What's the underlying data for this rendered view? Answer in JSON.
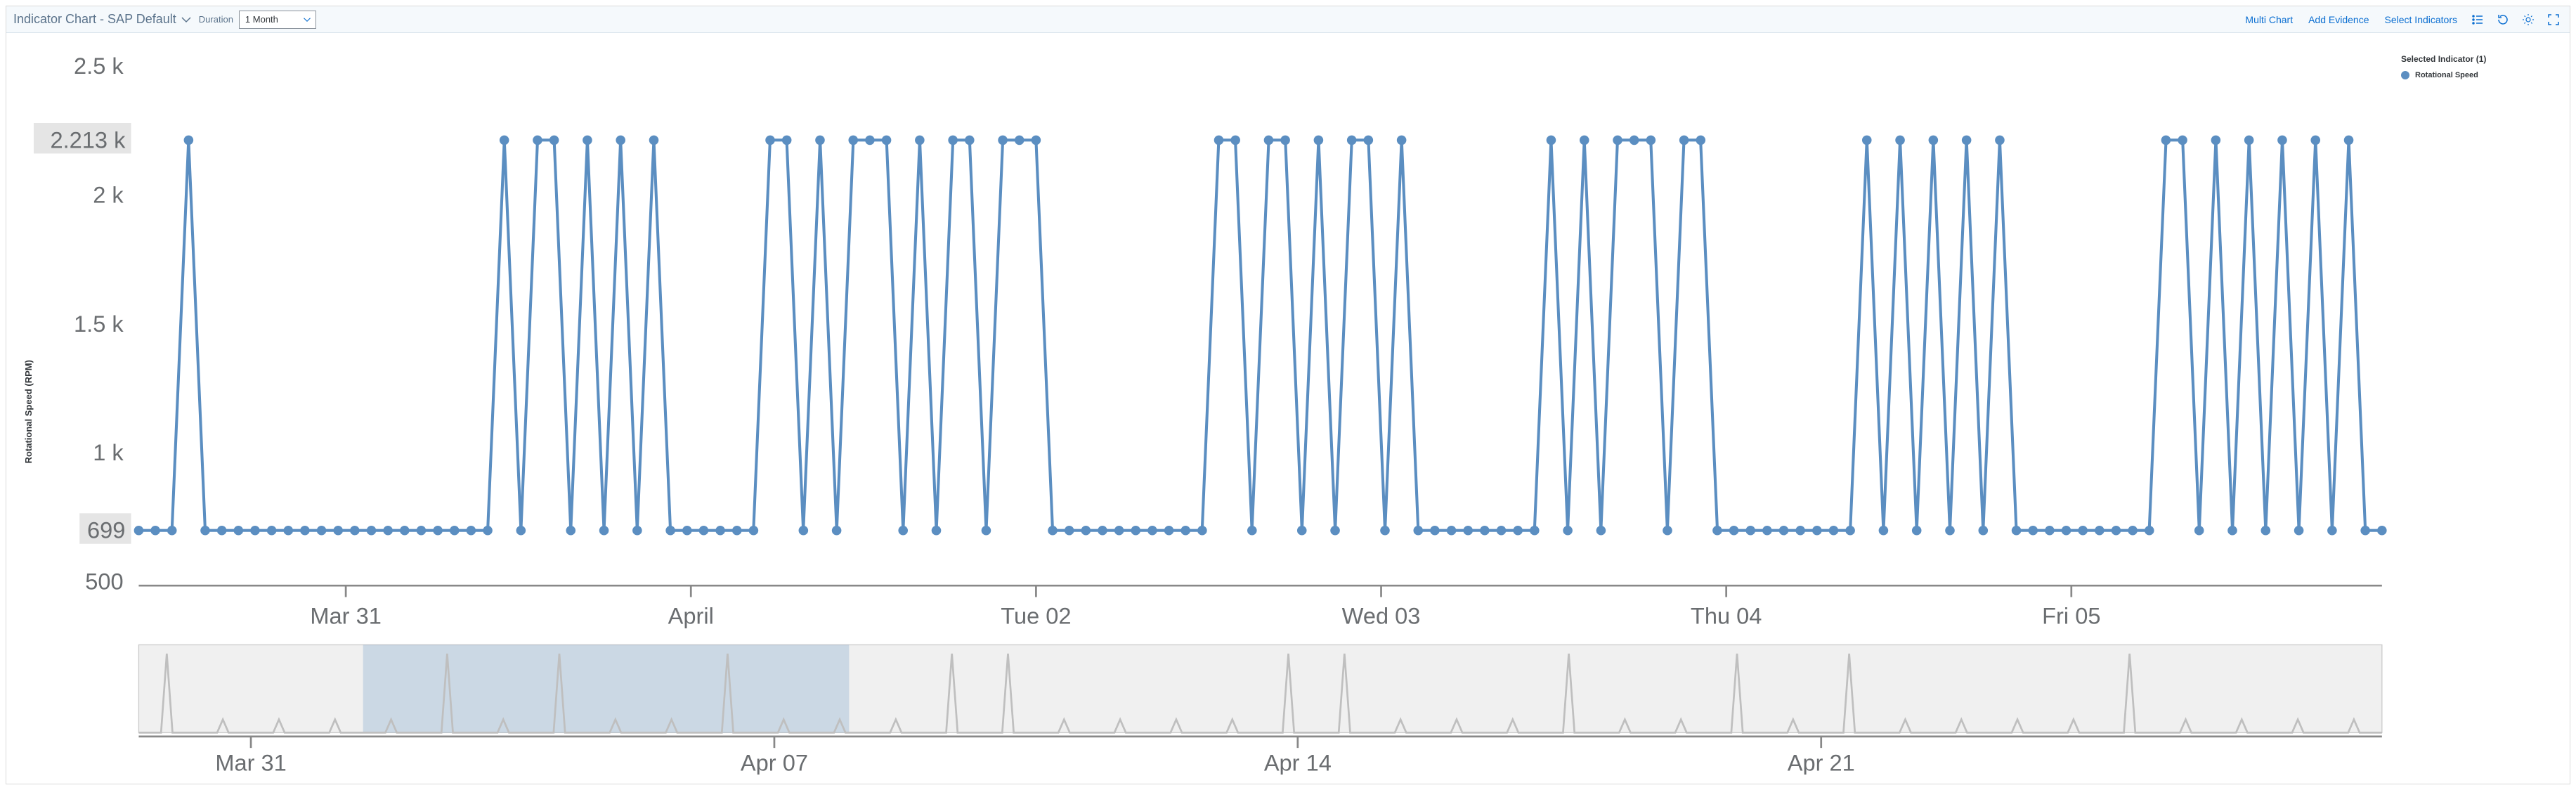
{
  "header": {
    "title": "Indicator Chart - SAP Default",
    "duration_label": "Duration",
    "duration_value": "1 Month",
    "actions": {
      "multi_chart": "Multi Chart",
      "add_evidence": "Add Evidence",
      "select_indicators": "Select Indicators"
    }
  },
  "legend": {
    "title": "Selected Indicator (1)",
    "items": [
      "Rotational Speed"
    ]
  },
  "colors": {
    "series": "#5b8ec1",
    "link": "#0a6ed1"
  },
  "chart_data": {
    "type": "line",
    "ylabel": "Rotational Speed (RPM)",
    "ylim": [
      500,
      2500
    ],
    "yticks": [
      500,
      "1 k",
      "1.5 k",
      "2 k",
      "2.5 k"
    ],
    "ytick_values": [
      500,
      1000,
      1500,
      2000,
      2500
    ],
    "ref_lines": [
      {
        "label": "2.213 k",
        "value": 2213
      },
      {
        "label": "699",
        "value": 699
      }
    ],
    "x_range_days": 6.5,
    "x_ticks": [
      {
        "label": "Mar 31",
        "pos": 0.6
      },
      {
        "label": "April",
        "pos": 1.6
      },
      {
        "label": "Tue 02",
        "pos": 2.6
      },
      {
        "label": "Wed 03",
        "pos": 3.6
      },
      {
        "label": "Thu 04",
        "pos": 4.6
      },
      {
        "label": "Fri 05",
        "pos": 5.6
      }
    ],
    "low_value": 699,
    "high_value": 2213,
    "series": [
      {
        "name": "Rotational Speed",
        "pattern": [
          "L",
          "L",
          "L",
          "H",
          "L",
          "L",
          "L",
          "L",
          "L",
          "L",
          "L",
          "L",
          "L",
          "L",
          "L",
          "L",
          "L",
          "L",
          "L",
          "L",
          "L",
          "L",
          "H",
          "L",
          "H",
          "H",
          "L",
          "H",
          "L",
          "H",
          "L",
          "H",
          "L",
          "L",
          "L",
          "L",
          "L",
          "L",
          "H",
          "H",
          "L",
          "H",
          "L",
          "H",
          "H",
          "H",
          "L",
          "H",
          "L",
          "H",
          "H",
          "L",
          "H",
          "H",
          "H",
          "L",
          "L",
          "L",
          "L",
          "L",
          "L",
          "L",
          "L",
          "L",
          "L",
          "H",
          "H",
          "L",
          "H",
          "H",
          "L",
          "H",
          "L",
          "H",
          "H",
          "L",
          "H",
          "L",
          "L",
          "L",
          "L",
          "L",
          "L",
          "L",
          "L",
          "H",
          "L",
          "H",
          "L",
          "H",
          "H",
          "H",
          "L",
          "H",
          "H",
          "L",
          "L",
          "L",
          "L",
          "L",
          "L",
          "L",
          "L",
          "L",
          "H",
          "L",
          "H",
          "L",
          "H",
          "L",
          "H",
          "L",
          "H",
          "L",
          "L",
          "L",
          "L",
          "L",
          "L",
          "L",
          "L",
          "L",
          "H",
          "H",
          "L",
          "H",
          "L",
          "H",
          "L",
          "H",
          "L",
          "H",
          "L",
          "H",
          "L",
          "L"
        ]
      }
    ],
    "overview": {
      "x_range_days": 30,
      "x_ticks": [
        {
          "label": "Mar 31",
          "pos": 1.5
        },
        {
          "label": "Apr 07",
          "pos": 8.5
        },
        {
          "label": "Apr 14",
          "pos": 15.5
        },
        {
          "label": "Apr 21",
          "pos": 22.5
        }
      ],
      "selection": {
        "start": 3.0,
        "end": 9.5
      }
    }
  }
}
